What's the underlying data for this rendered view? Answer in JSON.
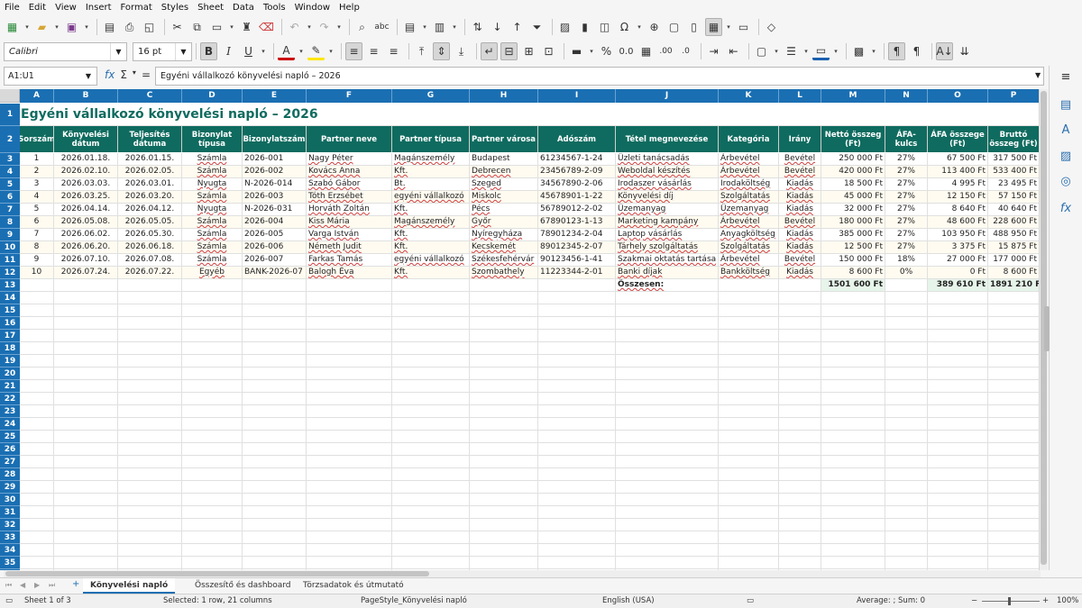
{
  "menubar": [
    "File",
    "Edit",
    "View",
    "Insert",
    "Format",
    "Styles",
    "Sheet",
    "Data",
    "Tools",
    "Window",
    "Help"
  ],
  "toolbar": {
    "font_name": "Calibri",
    "font_size": "16 pt"
  },
  "formula_bar": {
    "name_box": "A1:U1",
    "formula": "Egyéni vállalkozó könyvelési napló – 2026"
  },
  "columns": [
    "A",
    "B",
    "C",
    "D",
    "E",
    "F",
    "G",
    "H",
    "I",
    "J",
    "K",
    "L",
    "M",
    "N",
    "O",
    "P"
  ],
  "row_numbers": [
    "1",
    "2",
    "3",
    "4",
    "5",
    "6",
    "7",
    "8",
    "9",
    "10",
    "11",
    "12",
    "13",
    "14",
    "15",
    "16",
    "17",
    "18",
    "19",
    "20",
    "21",
    "22",
    "23",
    "24",
    "25",
    "26",
    "27",
    "28",
    "29",
    "30",
    "31",
    "32",
    "33",
    "34",
    "35",
    "36"
  ],
  "sheet": {
    "title": "Egyéni vállalkozó könyvelési napló – 2026",
    "headers": [
      "Sorszám",
      "Könyvelési dátum",
      "Teljesítés dátuma",
      "Bizonylat típusa",
      "Bizonylatszám",
      "Partner neve",
      "Partner típusa",
      "Partner városa",
      "Adószám",
      "Tétel megnevezése",
      "Kategória",
      "Irány",
      "Nettó összeg (Ft)",
      "ÁFA-kulcs",
      "ÁFA összege (Ft)",
      "Bruttó összeg (Ft)"
    ],
    "rows": [
      [
        "1",
        "2026.01.18.",
        "2026.01.15.",
        "Számla",
        "2026-001",
        "Nagy Péter",
        "Magánszemély",
        "Budapest",
        "61234567-1-24",
        "Üzleti tanácsadás",
        "Árbevétel",
        "Bevétel",
        "250 000 Ft",
        "27%",
        "67 500 Ft",
        "317 500 Ft"
      ],
      [
        "2",
        "2026.02.10.",
        "2026.02.05.",
        "Számla",
        "2026-002",
        "Kovács Anna",
        "Kft.",
        "Debrecen",
        "23456789-2-09",
        "Weboldal készítés",
        "Árbevétel",
        "Bevétel",
        "420 000 Ft",
        "27%",
        "113 400 Ft",
        "533 400 Ft"
      ],
      [
        "3",
        "2026.03.03.",
        "2026.03.01.",
        "Nyugta",
        "N-2026-014",
        "Szabó Gábor",
        "Bt.",
        "Szeged",
        "34567890-2-06",
        "Irodaszer vásárlás",
        "Irodaköltség",
        "Kiadás",
        "18 500 Ft",
        "27%",
        "4 995 Ft",
        "23 495 Ft"
      ],
      [
        "4",
        "2026.03.25.",
        "2026.03.20.",
        "Számla",
        "2026-003",
        "Tóth Erzsébet",
        "egyéni vállalkozó",
        "Miskolc",
        "45678901-1-22",
        "Könyvelési díj",
        "Szolgáltatás",
        "Kiadás",
        "45 000 Ft",
        "27%",
        "12 150 Ft",
        "57 150 Ft"
      ],
      [
        "5",
        "2026.04.14.",
        "2026.04.12.",
        "Nyugta",
        "N-2026-031",
        "Horváth Zoltán",
        "Kft.",
        "Pécs",
        "56789012-2-02",
        "Üzemanyag",
        "Üzemanyag",
        "Kiadás",
        "32 000 Ft",
        "27%",
        "8 640 Ft",
        "40 640 Ft"
      ],
      [
        "6",
        "2026.05.08.",
        "2026.05.05.",
        "Számla",
        "2026-004",
        "Kiss Mária",
        "Magánszemély",
        "Győr",
        "67890123-1-13",
        "Marketing kampány",
        "Árbevétel",
        "Bevétel",
        "180 000 Ft",
        "27%",
        "48 600 Ft",
        "228 600 Ft"
      ],
      [
        "7",
        "2026.06.02.",
        "2026.05.30.",
        "Számla",
        "2026-005",
        "Varga István",
        "Kft.",
        "Nyíregyháza",
        "78901234-2-04",
        "Laptop vásárlás",
        "Anyagköltség",
        "Kiadás",
        "385 000 Ft",
        "27%",
        "103 950 Ft",
        "488 950 Ft"
      ],
      [
        "8",
        "2026.06.20.",
        "2026.06.18.",
        "Számla",
        "2026-006",
        "Németh Judit",
        "Kft.",
        "Kecskemét",
        "89012345-2-07",
        "Tárhely szolgáltatás",
        "Szolgáltatás",
        "Kiadás",
        "12 500 Ft",
        "27%",
        "3 375 Ft",
        "15 875 Ft"
      ],
      [
        "9",
        "2026.07.10.",
        "2026.07.08.",
        "Számla",
        "2026-007",
        "Farkas Tamás",
        "egyéni vállalkozó",
        "Székesfehérvár",
        "90123456-1-41",
        "Szakmai oktatás tartása",
        "Árbevétel",
        "Bevétel",
        "150 000 Ft",
        "18%",
        "27 000 Ft",
        "177 000 Ft"
      ],
      [
        "10",
        "2026.07.24.",
        "2026.07.22.",
        "Egyéb",
        "BANK-2026-07",
        "Balogh Éva",
        "Kft.",
        "Szombathely",
        "11223344-2-01",
        "Banki díjak",
        "Bankköltség",
        "Kiadás",
        "8 600 Ft",
        "0%",
        "0 Ft",
        "8 600 Ft"
      ]
    ],
    "total_label": "Összesen:",
    "totals": {
      "net": "1501 600 Ft",
      "vat": "389 610 Ft",
      "gross": "1891 210 Ft"
    }
  },
  "tabs": [
    "Könyvelési napló",
    "Összesítő és dashboard",
    "Törzsadatok és útmutató"
  ],
  "status": {
    "sheet": "Sheet 1 of 3",
    "selected": "Selected: 1 row, 21 columns",
    "page_style": "PageStyle_Könyvelési napló",
    "language": "English (USA)",
    "summary": "Average: ; Sum: 0",
    "zoom": "100%"
  },
  "colors": {
    "header_bg": "#1a6fb3",
    "table_header": "#0f6b5f",
    "title": "#0f6b5f"
  }
}
